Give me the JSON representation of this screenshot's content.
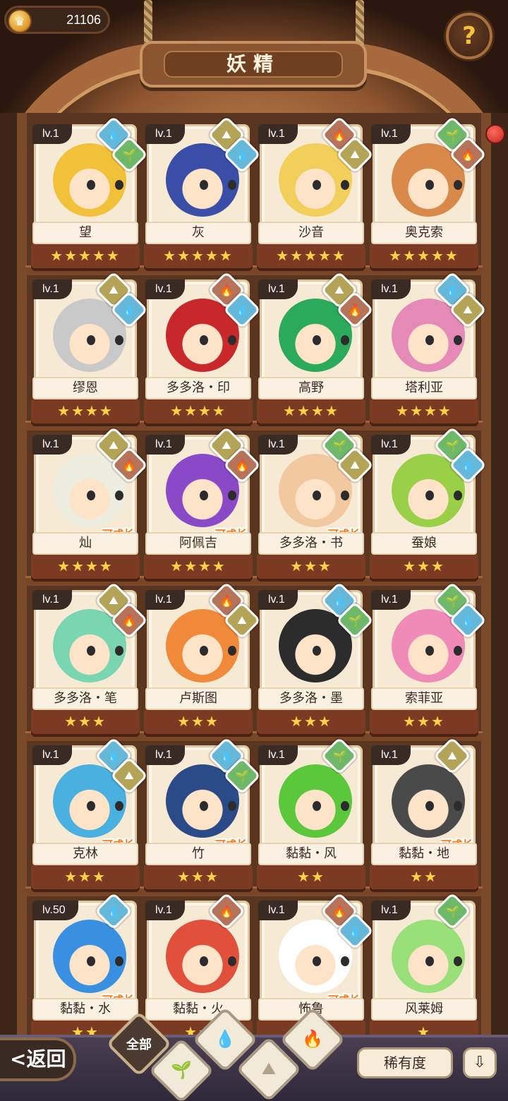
{
  "header": {
    "coins": "21106",
    "title": "妖精",
    "help_symbol": "?"
  },
  "element_colors": {
    "water": "#66b8d8",
    "earth": "#b4a458",
    "fire": "#b5735a",
    "grass": "#6fb86a"
  },
  "element_glyphs": {
    "water": "💧",
    "earth": "⛰",
    "fire": "🔥",
    "grass": "🌱"
  },
  "fairies": [
    {
      "name": "望",
      "level": "lv.1",
      "stars": "★★★★★",
      "elements": [
        "water",
        "grass"
      ],
      "growable": "",
      "hair": "#f2c13a"
    },
    {
      "name": "灰",
      "level": "lv.1",
      "stars": "★★★★★",
      "elements": [
        "earth",
        "water"
      ],
      "growable": "",
      "hair": "#3a4ea8"
    },
    {
      "name": "沙音",
      "level": "lv.1",
      "stars": "★★★★★",
      "elements": [
        "fire",
        "earth"
      ],
      "growable": "",
      "hair": "#f2cf5a"
    },
    {
      "name": "奥克索",
      "level": "lv.1",
      "stars": "★★★★★",
      "elements": [
        "grass",
        "fire"
      ],
      "growable": "",
      "hair": "#d98a4a"
    },
    {
      "name": "缪恩",
      "level": "lv.1",
      "stars": "★★★★",
      "elements": [
        "earth",
        "water"
      ],
      "growable": "",
      "hair": "#c9c9c9"
    },
    {
      "name": "多多洛・印",
      "level": "lv.1",
      "stars": "★★★★",
      "elements": [
        "fire",
        "water"
      ],
      "growable": "",
      "hair": "#c8282a"
    },
    {
      "name": "高野",
      "level": "lv.1",
      "stars": "★★★★",
      "elements": [
        "earth",
        "fire"
      ],
      "growable": "",
      "hair": "#2aaa5a"
    },
    {
      "name": "塔利亚",
      "level": "lv.1",
      "stars": "★★★★",
      "elements": [
        "water",
        "earth"
      ],
      "growable": "",
      "hair": "#e58ab6"
    },
    {
      "name": "灿",
      "level": "lv.1",
      "stars": "★★★★",
      "elements": [
        "earth",
        "fire"
      ],
      "growable": "可成长",
      "hair": "#eeeee0"
    },
    {
      "name": "阿佩吉",
      "level": "lv.1",
      "stars": "★★★★",
      "elements": [
        "earth",
        "fire"
      ],
      "growable": "可成长",
      "hair": "#8a4ac8"
    },
    {
      "name": "多多洛・书",
      "level": "lv.1",
      "stars": "★★★",
      "elements": [
        "grass",
        "earth"
      ],
      "growable": "可成长",
      "hair": "#f2c8a0"
    },
    {
      "name": "蚕娘",
      "level": "lv.1",
      "stars": "★★★",
      "elements": [
        "grass",
        "water"
      ],
      "growable": "",
      "hair": "#9ad048"
    },
    {
      "name": "多多洛・笔",
      "level": "lv.1",
      "stars": "★★★",
      "elements": [
        "earth",
        "fire"
      ],
      "growable": "",
      "hair": "#7ad6b0"
    },
    {
      "name": "卢斯图",
      "level": "lv.1",
      "stars": "★★★",
      "elements": [
        "fire",
        "earth"
      ],
      "growable": "",
      "hair": "#f08a3a"
    },
    {
      "name": "多多洛・墨",
      "level": "lv.1",
      "stars": "★★★",
      "elements": [
        "water",
        "grass"
      ],
      "growable": "",
      "hair": "#2c2c2c"
    },
    {
      "name": "索菲亚",
      "level": "lv.1",
      "stars": "★★★",
      "elements": [
        "grass",
        "water"
      ],
      "growable": "",
      "hair": "#f08ab6"
    },
    {
      "name": "克林",
      "level": "lv.1",
      "stars": "★★★",
      "elements": [
        "water",
        "earth"
      ],
      "growable": "可成长",
      "hair": "#4ab0e0"
    },
    {
      "name": "竹",
      "level": "lv.1",
      "stars": "★★★",
      "elements": [
        "water",
        "grass"
      ],
      "growable": "可成长",
      "hair": "#2a4a88"
    },
    {
      "name": "黏黏・风",
      "level": "lv.1",
      "stars": "★★",
      "elements": [
        "grass"
      ],
      "growable": "",
      "hair": "#5ac83a"
    },
    {
      "name": "黏黏・地",
      "level": "lv.1",
      "stars": "★★",
      "elements": [
        "earth"
      ],
      "growable": "可成长",
      "hair": "#4a4a4a"
    },
    {
      "name": "黏黏・水",
      "level": "lv.50",
      "stars": "★★",
      "elements": [
        "water"
      ],
      "growable": "可成长",
      "hair": "#3a90e0"
    },
    {
      "name": "黏黏・火",
      "level": "lv.1",
      "stars": "★★",
      "elements": [
        "fire"
      ],
      "growable": "",
      "hair": "#e0503a"
    },
    {
      "name": "怖鲁",
      "level": "lv.1",
      "stars": "★",
      "elements": [
        "fire",
        "water"
      ],
      "growable": "可成长",
      "hair": "#ffffff"
    },
    {
      "name": "风莱姆",
      "level": "lv.1",
      "stars": "★",
      "elements": [
        "grass"
      ],
      "growable": "",
      "hair": "#9ae07a"
    }
  ],
  "bottom_bar": {
    "back_label": "返回",
    "back_arrow": "<",
    "filters": [
      {
        "label": "全部",
        "icon": "all-icon",
        "glyph": "",
        "active": true
      },
      {
        "label": "",
        "icon": "grass-icon",
        "glyph": "🌱",
        "active": false
      },
      {
        "label": "",
        "icon": "water-icon",
        "glyph": "💧",
        "active": false
      },
      {
        "label": "",
        "icon": "earth-icon",
        "glyph": "⛰",
        "active": false
      },
      {
        "label": "",
        "icon": "fire-icon",
        "glyph": "🔥",
        "active": false
      }
    ],
    "sort_label": "稀有度",
    "sort_order_icon": "⇩"
  }
}
